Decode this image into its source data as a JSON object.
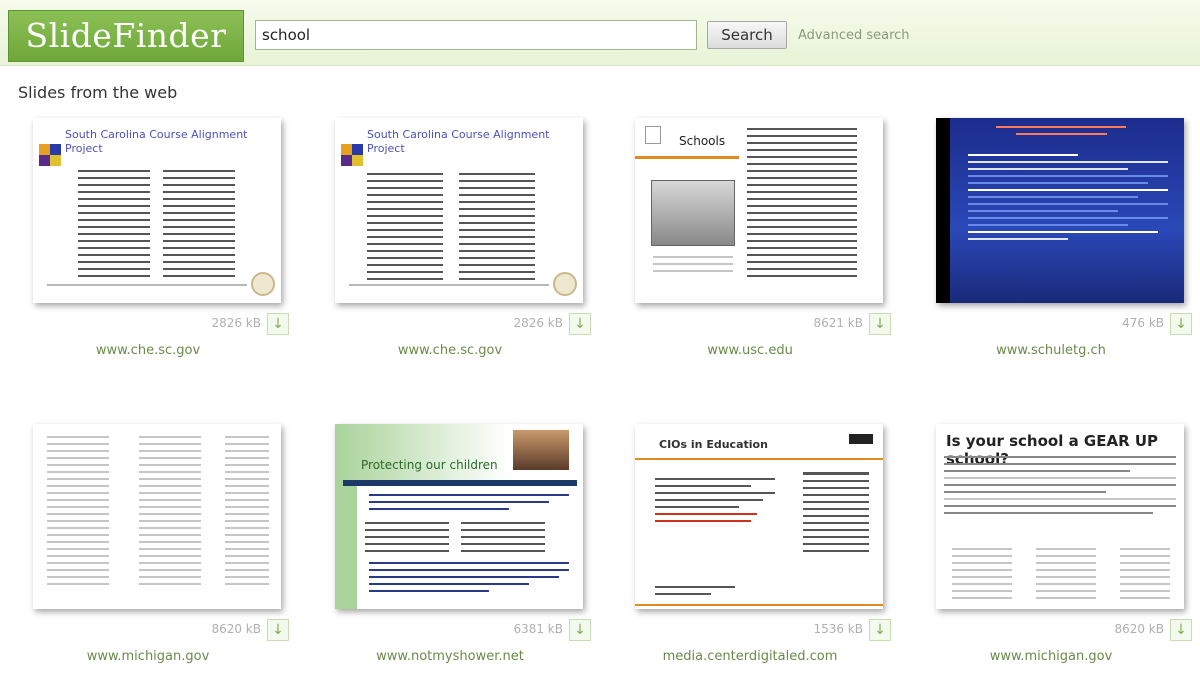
{
  "header": {
    "logo": "SlideFinder",
    "search_value": "school",
    "search_button": "Search",
    "advanced_link": "Advanced search"
  },
  "section_title": "Slides from the web",
  "results": [
    {
      "source": "www.che.sc.gov",
      "size": "2826 kB",
      "thumb_title": "South Carolina Course Alignment Project"
    },
    {
      "source": "www.che.sc.gov",
      "size": "2826 kB",
      "thumb_title": "South Carolina Course Alignment Project"
    },
    {
      "source": "www.usc.edu",
      "size": "8621 kB",
      "thumb_title": "Schools"
    },
    {
      "source": "www.schuletg.ch",
      "size": "476 kB",
      "thumb_title": ""
    },
    {
      "source": "www.michigan.gov",
      "size": "8620 kB",
      "thumb_title": ""
    },
    {
      "source": "www.notmyshower.net",
      "size": "6381 kB",
      "thumb_title": "Protecting our children"
    },
    {
      "source": "media.centerdigitaled.com",
      "size": "1536 kB",
      "thumb_title": "CIOs in Education"
    },
    {
      "source": "www.michigan.gov",
      "size": "8620 kB",
      "thumb_title": "Is your school a GEAR UP school?"
    }
  ],
  "icons": {
    "download": "download-arrow-icon"
  },
  "colors": {
    "brand_green": "#78b045",
    "link_green": "#6a8a4a",
    "header_bg": "#eef6e2"
  }
}
